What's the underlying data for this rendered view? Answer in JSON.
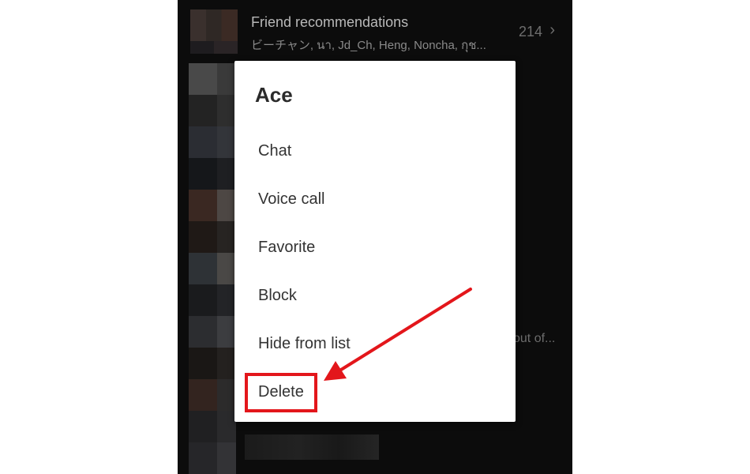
{
  "friend_recommendations": {
    "title": "Friend recommendations",
    "names": "ビーチャン, นา, Jd_Ch, Heng, Noncha, กุช...",
    "count": "214",
    "chevron": "›"
  },
  "background": {
    "snippet": "out of..."
  },
  "dialog": {
    "title": "Ace",
    "items": [
      {
        "label": "Chat"
      },
      {
        "label": "Voice call"
      },
      {
        "label": "Favorite"
      },
      {
        "label": "Block"
      },
      {
        "label": "Hide from list"
      },
      {
        "label": "Delete"
      }
    ]
  },
  "annotation": {
    "color": "#e3161b",
    "highlighted_item": "Delete"
  }
}
